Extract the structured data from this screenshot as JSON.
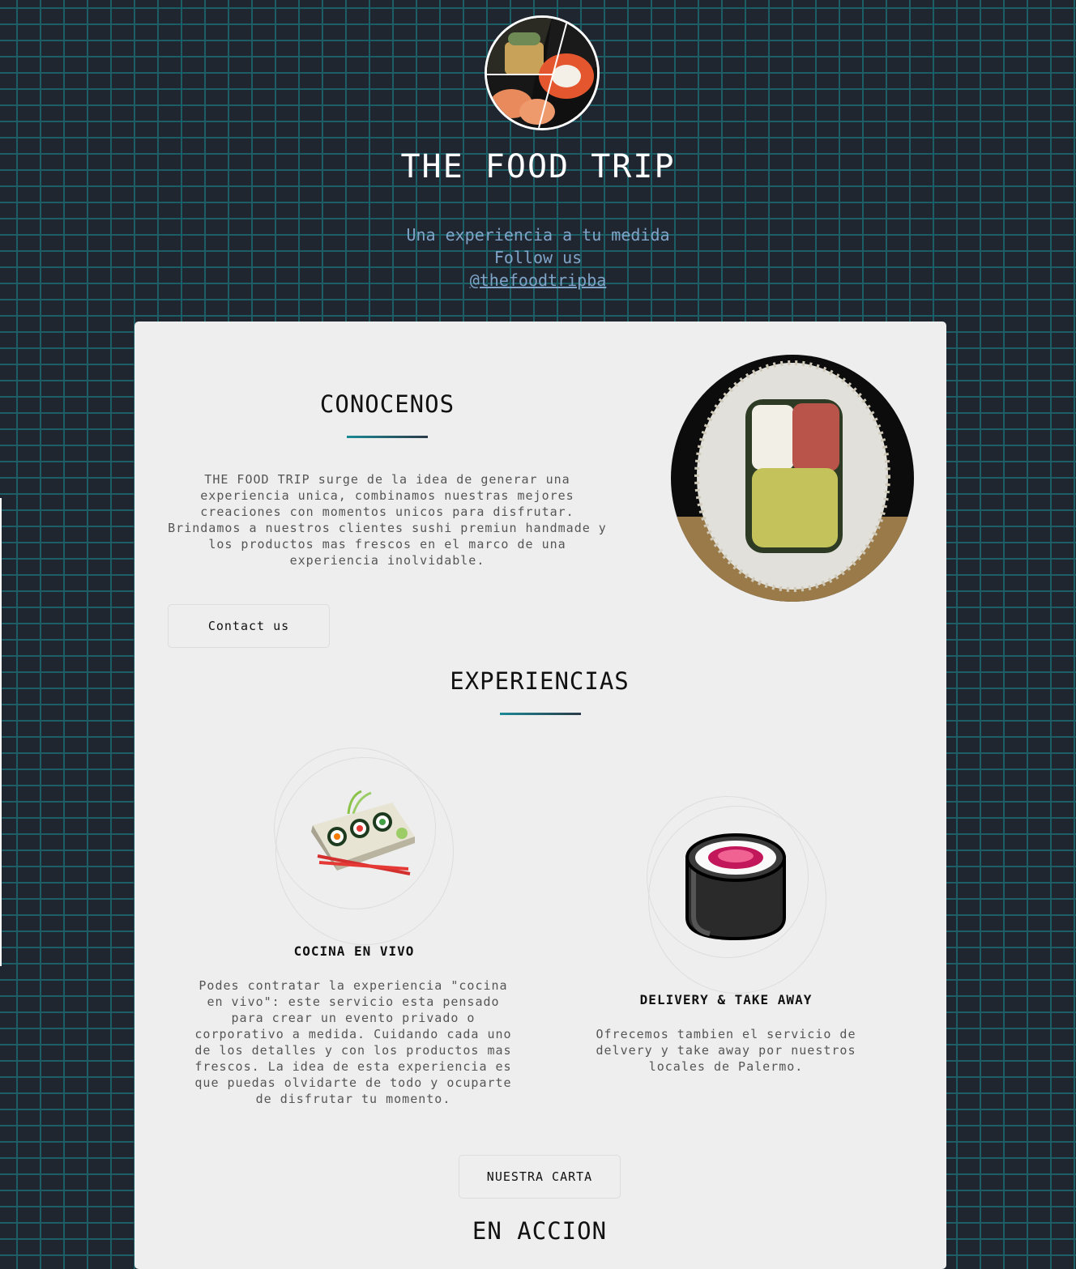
{
  "header": {
    "logo_alt": "sushi collage",
    "title": "THE FOOD TRIP",
    "tagline": "Una experiencia a tu medida",
    "follow": "Follow us",
    "handle": "@thefoodtripba"
  },
  "about": {
    "title": "CONOCENOS",
    "text": "THE FOOD TRIP surge de la idea de generar una experiencia unica, combinamos nuestras mejores creaciones con momentos unicos para disfrutar. Brindamos a nuestros clientes sushi premiun handmade y los productos mas frescos en el marco de una experiencia inolvidable.",
    "contact_button": "Contact us"
  },
  "experiences": {
    "title": "EXPERIENCIAS",
    "items": [
      {
        "title": "COCINA EN VIVO",
        "icon": "sushi-platter-icon",
        "text": "Podes contratar la experiencia \"cocina en vivo\": este servicio esta pensado para crear un evento privado o corporativo a medida. Cuidando cada uno de los detalles y con los productos mas frescos. La idea de esta experiencia es que puedas olvidarte de todo y ocuparte de disfrutar tu momento."
      },
      {
        "title": "DELIVERY & TAKE AWAY",
        "icon": "sushi-roll-icon",
        "text": "Ofrecemos tambien el servicio de delvery y take away por nuestros locales de Palermo."
      }
    ],
    "menu_button": "NUESTRA CARTA"
  },
  "action": {
    "title": "EN ACCION"
  },
  "colors": {
    "background": "#1f2630",
    "brick_lines": "#1b5e66",
    "card": "#eeeeee",
    "link": "#7fa4c8",
    "accent": "#1b8a95"
  }
}
